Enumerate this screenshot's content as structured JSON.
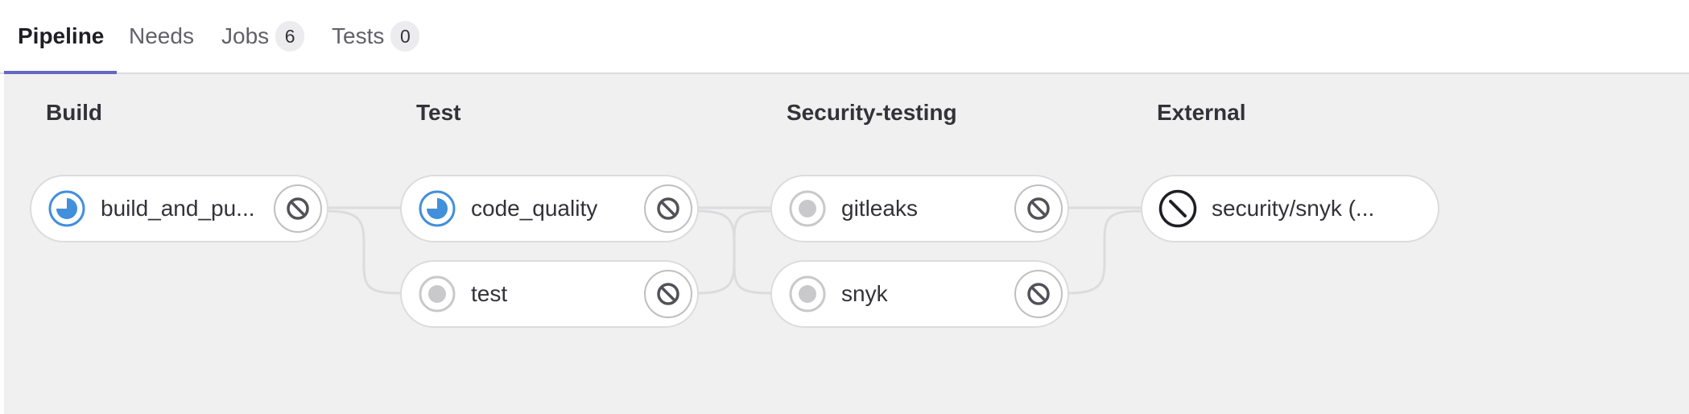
{
  "tabs": [
    {
      "label": "Pipeline",
      "active": true
    },
    {
      "label": "Needs"
    },
    {
      "label": "Jobs",
      "count": "6"
    },
    {
      "label": "Tests",
      "count": "0"
    }
  ],
  "stages": [
    {
      "title": "Build"
    },
    {
      "title": "Test"
    },
    {
      "title": "Security-testing"
    },
    {
      "title": "External"
    }
  ],
  "jobs": {
    "build_and_push": {
      "name": "build_and_pu...",
      "status": "running",
      "status_icon": "status-running-icon",
      "action_icon": "cancel-icon"
    },
    "code_quality": {
      "name": "code_quality",
      "status": "running",
      "status_icon": "status-running-icon",
      "action_icon": "cancel-icon"
    },
    "test": {
      "name": "test",
      "status": "created",
      "status_icon": "status-created-icon",
      "action_icon": "cancel-icon"
    },
    "gitleaks": {
      "name": "gitleaks",
      "status": "created",
      "status_icon": "status-created-icon",
      "action_icon": "cancel-icon"
    },
    "snyk": {
      "name": "snyk",
      "status": "created",
      "status_icon": "status-created-icon",
      "action_icon": "cancel-icon"
    },
    "security_snyk": {
      "name": "security/snyk (...",
      "status": "skipped",
      "status_icon": "status-skipped-icon"
    }
  },
  "colors": {
    "tab_underline": "#6666c4",
    "graph_background": "#f0f0f0",
    "running": "#428fdc",
    "created": "#c9c9cc",
    "link": "#dcdcde"
  }
}
